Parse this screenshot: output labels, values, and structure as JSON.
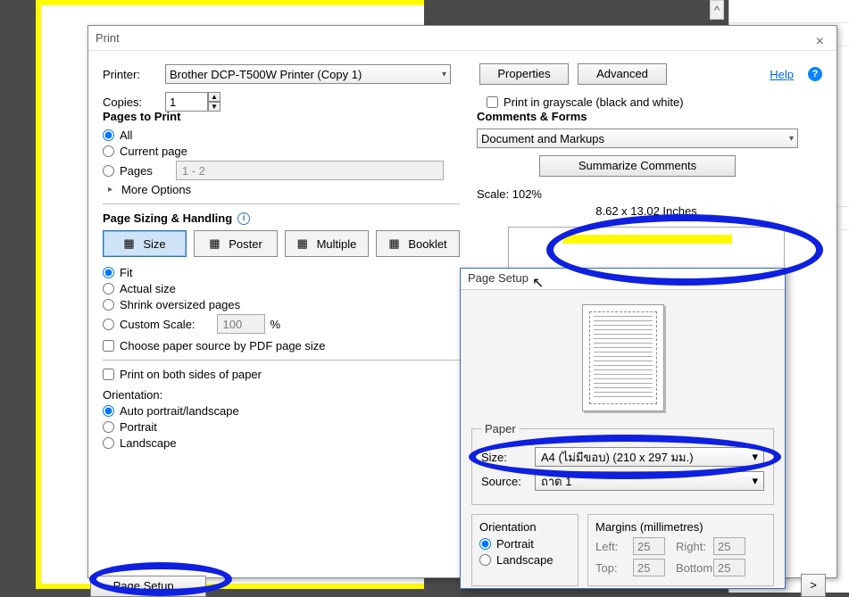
{
  "print": {
    "title": "Print",
    "printer_label": "Printer:",
    "printer_value": "Brother DCP-T500W Printer (Copy 1)",
    "properties_btn": "Properties",
    "advanced_btn": "Advanced",
    "help_link": "Help",
    "copies_label": "Copies:",
    "copies_value": "1",
    "grayscale_label": "Print in grayscale (black and white)",
    "pages_hdr": "Pages to Print",
    "opt_all": "All",
    "opt_current": "Current page",
    "opt_pages": "Pages",
    "pages_range": "1 - 2",
    "more_options": "More Options",
    "sizing_hdr": "Page Sizing & Handling",
    "btn_size": "Size",
    "btn_poster": "Poster",
    "btn_multiple": "Multiple",
    "btn_booklet": "Booklet",
    "fit": "Fit",
    "actual": "Actual size",
    "shrink": "Shrink oversized pages",
    "custom_scale": "Custom Scale:",
    "custom_scale_value": "100",
    "pct": "%",
    "choose_source": "Choose paper source by PDF page size",
    "both_sides": "Print on both sides of paper",
    "orientation_hdr": "Orientation:",
    "orient_auto": "Auto portrait/landscape",
    "orient_portrait": "Portrait",
    "orient_landscape": "Landscape",
    "comments_hdr": "Comments & Forms",
    "comments_value": "Document and Markups",
    "summarize_btn": "Summarize Comments",
    "scale_label": "Scale: 102%",
    "paper_dims": "8.62 x 13.02 Inches",
    "page_setup_btn": "Page Setup...",
    "next_btn": ">"
  },
  "page_setup": {
    "title": "Page Setup",
    "paper_legend": "Paper",
    "size_label": "Size:",
    "size_value": "A4 (ไม่มีขอบ) (210 x 297 มม.)",
    "source_label": "Source:",
    "source_value": "ถาด 1",
    "orientation_legend": "Orientation",
    "portrait": "Portrait",
    "landscape": "Landscape",
    "margins_legend": "Margins (millimetres)",
    "left_l": "Left:",
    "left_v": "25",
    "right_l": "Right:",
    "right_v": "25",
    "top_l": "Top:",
    "top_v": "25",
    "bottom_l": "Bottom:",
    "bottom_v": "25"
  }
}
